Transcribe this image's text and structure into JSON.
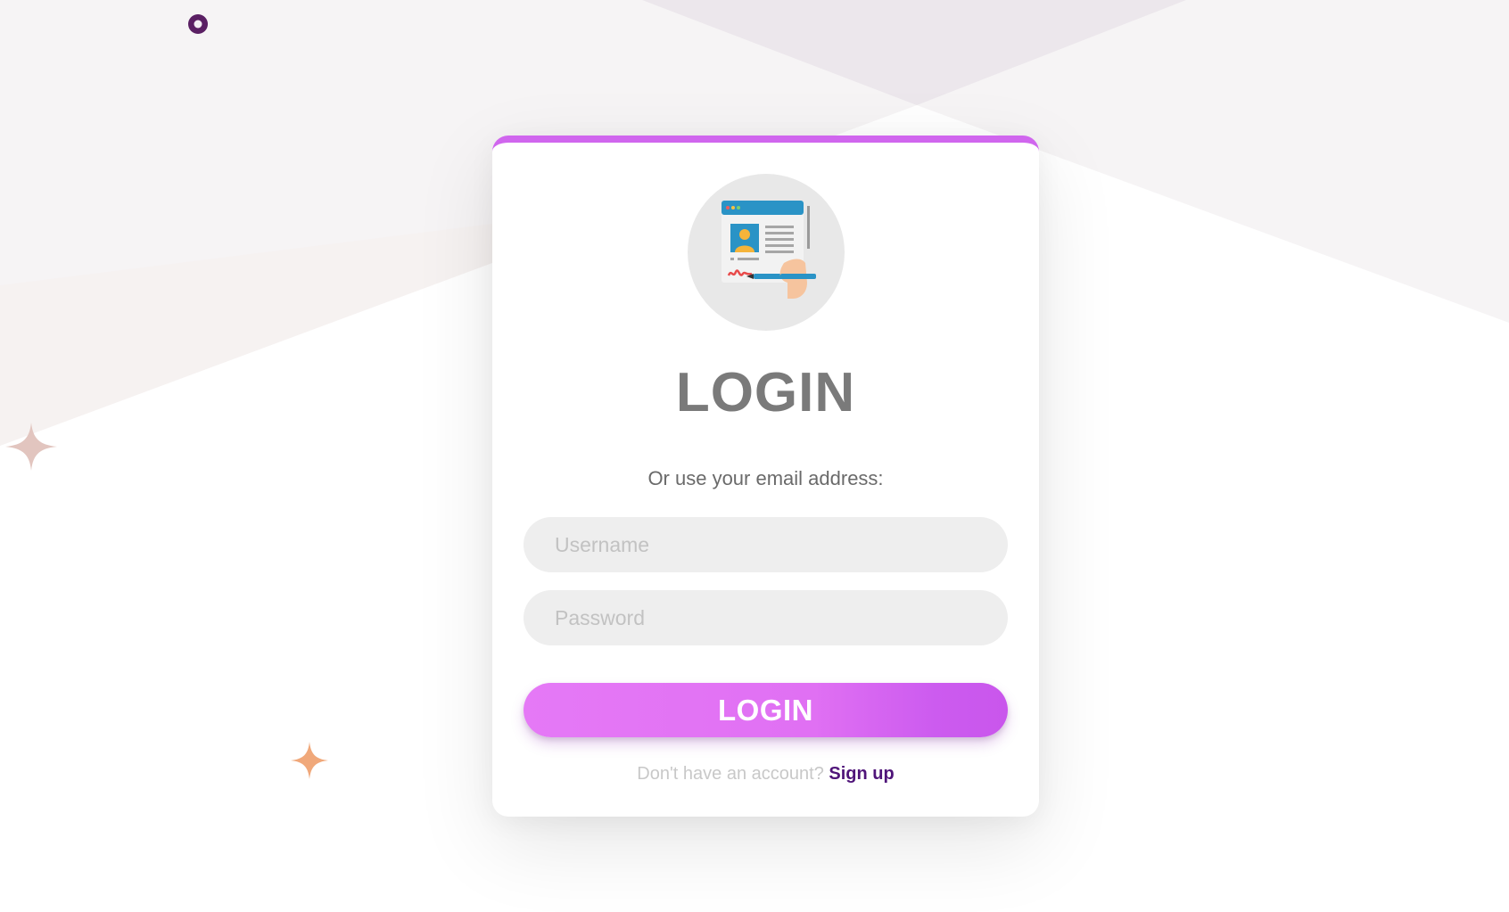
{
  "login": {
    "heading": "LOGIN",
    "subtitle": "Or use your email address:",
    "username_placeholder": "Username",
    "password_placeholder": "Password",
    "submit_label": "LOGIN",
    "footer_prompt": "Don't have an account?",
    "signup_link": "Sign up"
  },
  "colors": {
    "accent": "#d066ee",
    "button_gradient_start": "#e579f6",
    "button_gradient_end": "#c956ec",
    "signup_link": "#4f1479",
    "input_background": "#eeeeee"
  },
  "icons": {
    "avatar": "registration-form-illustration",
    "decorations": [
      "ring-icon",
      "sparkle-icon",
      "sparkle-icon"
    ]
  }
}
